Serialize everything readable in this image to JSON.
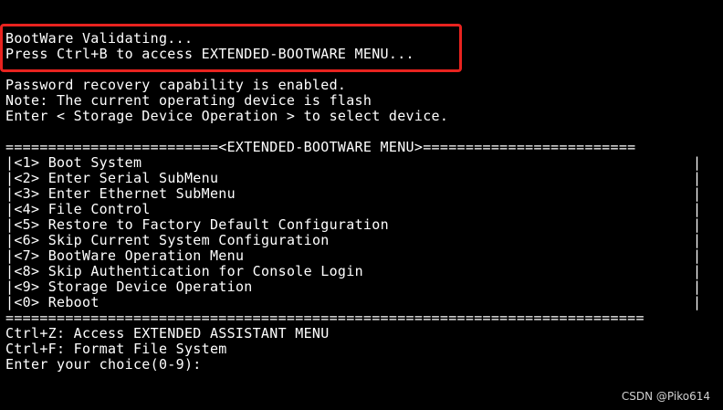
{
  "boot": {
    "line1": "BootWare Validating...",
    "line2": "Press Ctrl+B to access EXTENDED-BOOTWARE MENU..."
  },
  "info": {
    "line1": "Password recovery capability is enabled.",
    "line2": "Note: The current operating device is flash",
    "line3": "Enter < Storage Device Operation > to select device."
  },
  "menu": {
    "header": "=========================<EXTENDED-BOOTWARE MENU>=========================",
    "footer": "===========================================================================",
    "items": [
      {
        "key": "<1>",
        "label": "Boot System"
      },
      {
        "key": "<2>",
        "label": "Enter Serial SubMenu"
      },
      {
        "key": "<3>",
        "label": "Enter Ethernet SubMenu"
      },
      {
        "key": "<4>",
        "label": "File Control"
      },
      {
        "key": "<5>",
        "label": "Restore to Factory Default Configuration"
      },
      {
        "key": "<6>",
        "label": "Skip Current System Configuration"
      },
      {
        "key": "<7>",
        "label": "BootWare Operation Menu"
      },
      {
        "key": "<8>",
        "label": "Skip Authentication for Console Login"
      },
      {
        "key": "<9>",
        "label": "Storage Device Operation"
      },
      {
        "key": "<0>",
        "label": "Reboot"
      }
    ]
  },
  "shortcuts": {
    "ctrl_z": "Ctrl+Z: Access EXTENDED ASSISTANT MENU",
    "ctrl_f": "Ctrl+F: Format File System",
    "prompt": "Enter your choice(0-9):"
  },
  "watermark": "CSDN @Piko614",
  "colors": {
    "background": "#000000",
    "text": "#ffffff",
    "highlight_border": "#e8231f"
  }
}
